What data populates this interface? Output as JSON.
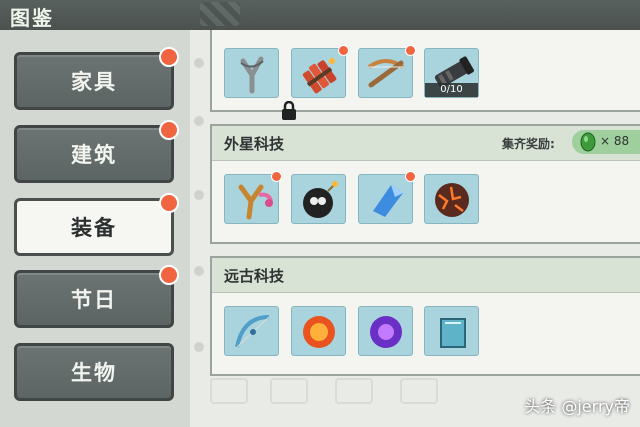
{
  "header": {
    "title": "图鉴"
  },
  "categories": [
    {
      "label": "家具",
      "active": false,
      "new": true
    },
    {
      "label": "建筑",
      "active": false,
      "new": true
    },
    {
      "label": "装备",
      "active": true,
      "new": true
    },
    {
      "label": "节日",
      "active": false,
      "new": true
    },
    {
      "label": "生物",
      "active": false,
      "new": false
    }
  ],
  "sections": {
    "top": {
      "items": [
        {
          "icon": "slingshot-icon",
          "locked": true
        },
        {
          "icon": "dynamite-icon",
          "new": true
        },
        {
          "icon": "crossbow-icon",
          "new": true
        },
        {
          "icon": "gatling-gun-icon",
          "progress": "0/10"
        }
      ]
    },
    "alien": {
      "title": "外星科技",
      "reward_label": "集齐奖励:",
      "reward_count": "× 88",
      "items": [
        {
          "icon": "alien-slingshot-icon",
          "new": true
        },
        {
          "icon": "bomb-icon"
        },
        {
          "icon": "blue-crystal-icon",
          "new": true
        },
        {
          "icon": "lava-rock-icon"
        }
      ]
    },
    "ancient": {
      "title": "远古科技",
      "items": [
        {
          "icon": "bow-icon"
        },
        {
          "icon": "fire-orb-icon"
        },
        {
          "icon": "void-orb-icon"
        },
        {
          "icon": "glass-pane-icon"
        }
      ]
    }
  },
  "watermark": "头条 @jerry帝",
  "colors": {
    "slot_bg": "#a9d4dd",
    "new_dot": "#f0643f",
    "reward_badge": "#9fcf9c"
  }
}
